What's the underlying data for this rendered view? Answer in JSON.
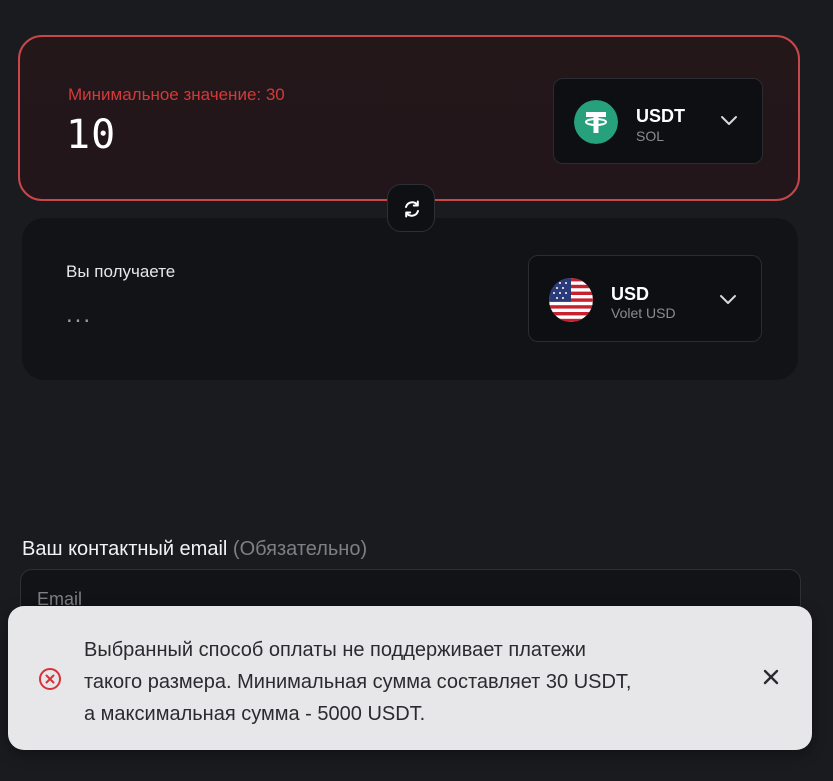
{
  "send": {
    "error_text": "Минимальное значение: 30",
    "amount": "10",
    "currency_code": "USDT",
    "currency_network": "SOL"
  },
  "receive": {
    "label": "Вы получаете",
    "value": "...",
    "currency_code": "USD",
    "currency_network": "Volet USD"
  },
  "email": {
    "label": "Ваш контактный email",
    "required_note": "(Обязательно)",
    "placeholder": "Email"
  },
  "toast": {
    "line1": "Выбранный способ оплаты не поддерживает платежи",
    "line2": "такого размера. Минимальная сумма составляет 30 USDT,",
    "line3": "а максимальная сумма - 5000 USDT."
  },
  "colors": {
    "error": "#d23a3a",
    "tether": "#26a17b",
    "background": "#1a1b1f"
  },
  "icons": [
    "tether-icon",
    "us-flag-icon",
    "chevron-down-icon",
    "swap-icon",
    "error-circle-icon",
    "close-icon"
  ]
}
